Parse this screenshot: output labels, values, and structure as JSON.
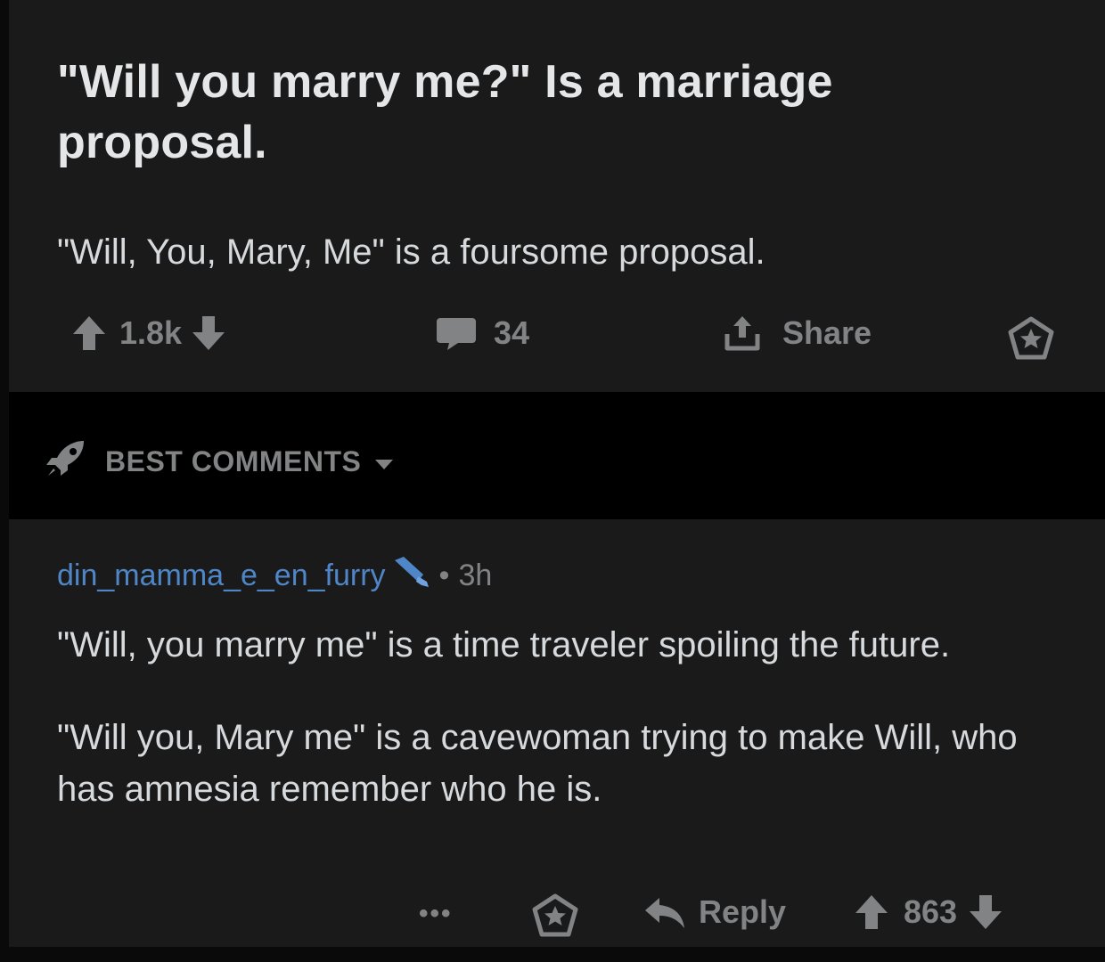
{
  "post": {
    "title": "\"Will you marry me?\" Is a marriage proposal.",
    "body": "\"Will, You, Mary, Me\" is a foursome proposal.",
    "score": "1.8k",
    "comment_count": "34",
    "share_label": "Share"
  },
  "sort": {
    "label": "BEST COMMENTS"
  },
  "comment": {
    "username": "din_mamma_e_en_furry",
    "dot": "•",
    "age": "3h",
    "paragraphs": [
      "\"Will, you marry me\" is a time traveler spoiling the future.",
      "\"Will you, Mary me\" is a cavewoman trying to make Will, who has amnesia remember who he is."
    ],
    "more": "•••",
    "reply_label": "Reply",
    "score": "863"
  },
  "colors": {
    "background": "#1a1a1b",
    "sort_bar": "#000000",
    "text": "#d7dadc",
    "muted": "#818384",
    "username": "#4f86c8"
  },
  "icons": {
    "upvote": "arrow-up-icon",
    "downvote": "arrow-down-icon",
    "comments": "speech-bubble-icon",
    "share": "share-upload-icon",
    "save": "star-badge-icon",
    "sort": "rocket-icon",
    "dropdown": "caret-down-icon",
    "flair": "brush-icon",
    "reply": "reply-arrow-icon"
  }
}
